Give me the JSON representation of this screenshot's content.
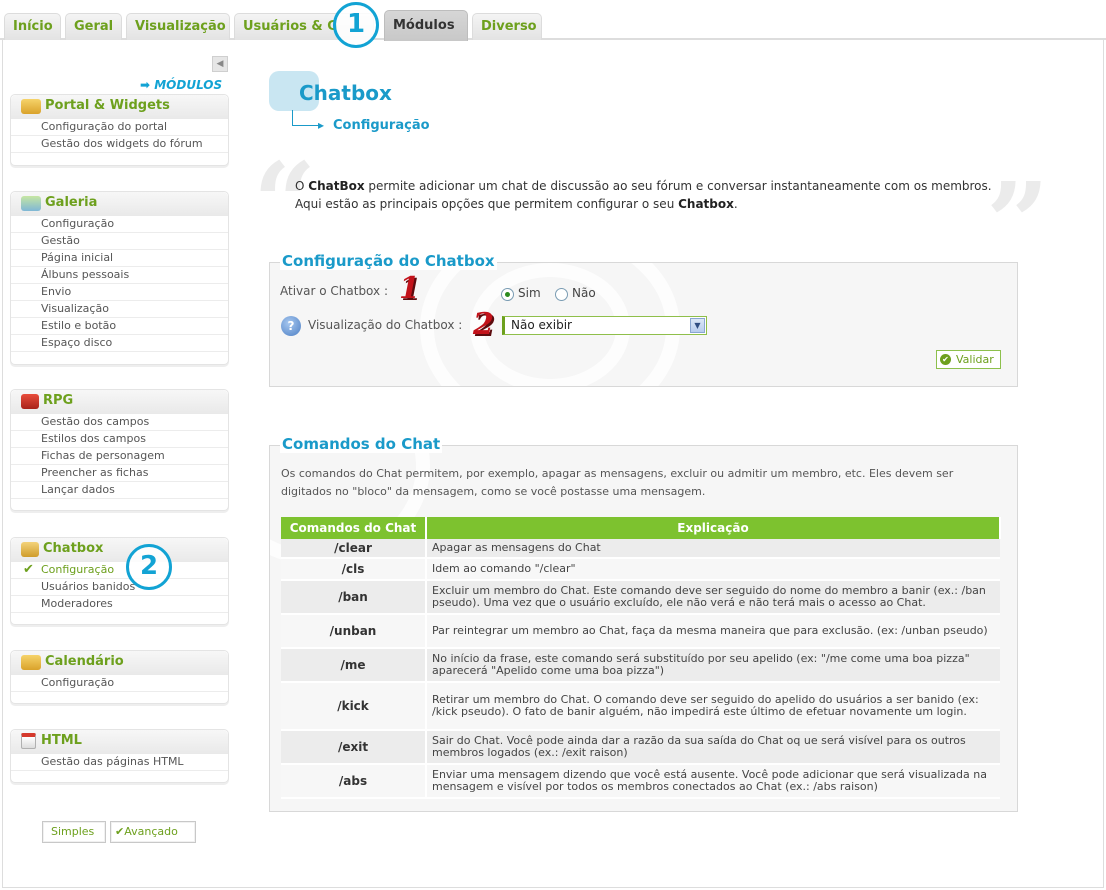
{
  "tabs": [
    {
      "label": "Início"
    },
    {
      "label": "Geral"
    },
    {
      "label": "Visualização"
    },
    {
      "label": "Usuários & G"
    },
    {
      "label": "Módulos"
    },
    {
      "label": "Diverso"
    }
  ],
  "callouts": {
    "one": "1",
    "two": "2"
  },
  "sidebar": {
    "section_label": "MÓDULOS",
    "collapse_icon": "◀",
    "groups": [
      {
        "title": "Portal & Widgets",
        "items": [
          "Configuração do portal",
          "Gestão dos widgets do fórum"
        ]
      },
      {
        "title": "Galeria",
        "items": [
          "Configuração",
          "Gestão",
          "Página inicial",
          "Álbuns pessoais",
          "Envio",
          "Visualização",
          "Estilo e botão",
          "Espaço disco"
        ]
      },
      {
        "title": "RPG",
        "items": [
          "Gestão dos campos",
          "Estilos dos campos",
          "Fichas de personagem",
          "Preencher as fichas",
          "Lançar dados"
        ]
      },
      {
        "title": "Chatbox",
        "items": [
          "Configuração",
          "Usuários banidos",
          "Moderadores"
        ]
      },
      {
        "title": "Calendário",
        "items": [
          "Configuração"
        ]
      },
      {
        "title": "HTML",
        "items": [
          "Gestão das páginas HTML"
        ]
      }
    ],
    "mode_simple": "Simples",
    "mode_advanced": "Avançado"
  },
  "page": {
    "title": "Chatbox",
    "subtitle": "Configuração",
    "intro_prefix": "O ",
    "intro_bold1": "ChatBox",
    "intro_mid": " permite adicionar um chat de discussão ao seu fórum e conversar instantaneamente com os membros. Aqui estão as principais opções que permitem configurar o seu ",
    "intro_bold2": "Chatbox",
    "intro_suffix": "."
  },
  "config": {
    "legend": "Configuração do Chatbox",
    "enable_label": "Ativar o Chatbox :",
    "opt_yes": "Sim",
    "opt_no": "Não",
    "enable_value": "Sim",
    "display_label": "Visualização do Chatbox :",
    "display_value": "Não exibir",
    "submit": "Validar",
    "marker1": "1",
    "marker2": "2"
  },
  "commands": {
    "legend": "Comandos do Chat",
    "intro": "Os comandos do Chat permitem, por exemplo, apagar as mensagens, excluir ou admitir um membro, etc. Eles devem ser digitados no \"bloco\" da mensagem, como se você postasse uma mensagem.",
    "col_command": "Comandos do Chat",
    "col_explanation": "Explicação",
    "rows": [
      {
        "cmd": "/clear",
        "text": "Apagar as mensagens do Chat"
      },
      {
        "cmd": "/cls",
        "text": "Idem ao comando \"/clear\""
      },
      {
        "cmd": "/ban",
        "text": "Excluir um membro do Chat. Este comando deve ser seguido do nome do membro a banir (ex.: /ban pseudo). Uma vez que o usuário excluído, ele não verá e não terá mais o acesso ao Chat."
      },
      {
        "cmd": "/unban",
        "text": "Par reintegrar um membro ao Chat, faça da mesma maneira que para exclusão. (ex: /unban pseudo)"
      },
      {
        "cmd": "/me",
        "text": "No início da frase, este comando será substituído por seu apelido (ex: \"/me come uma boa pizza\" aparecerá \"Apelido come uma boa pizza\")"
      },
      {
        "cmd": "/kick",
        "text": "Retirar um membro do Chat. O comando deve ser seguido do apelido do usuários a ser banido (ex: /kick pseudo). O fato de banir alguém, não impedirá este último de efetuar novamente um login."
      },
      {
        "cmd": "/exit",
        "text": "Sair do Chat. Você pode ainda dar a razão da sua saída do Chat oq ue será visível para os outros membros logados (ex.: /exit raison)"
      },
      {
        "cmd": "/abs",
        "text": "Enviar uma mensagem dizendo que você está ausente. Você pode adicionar que será visualizada na mensagem e visível por todos os membros conectados ao Chat (ex.: /abs raison)"
      }
    ]
  }
}
